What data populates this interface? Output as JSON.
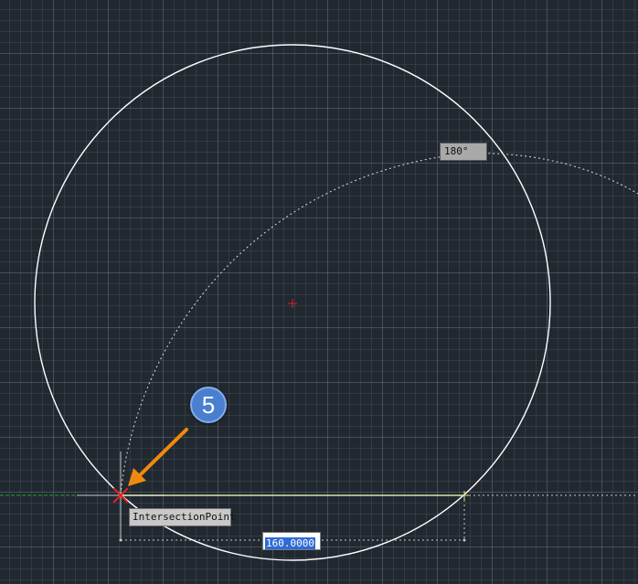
{
  "angle_tooltip": {
    "text": "180°"
  },
  "snap_tooltip": {
    "text": "IntersectionPoint"
  },
  "dimension_input": {
    "value": "160.0000"
  },
  "step_badge": {
    "number": "5"
  },
  "colors": {
    "background": "#212830",
    "circle": "#ffffff",
    "tracking": "#dcdcdc",
    "snap_marker": "#e02020",
    "arrow": "#f0890f",
    "green_axis": "#1fa81f",
    "badge": "#4a7fd0"
  }
}
